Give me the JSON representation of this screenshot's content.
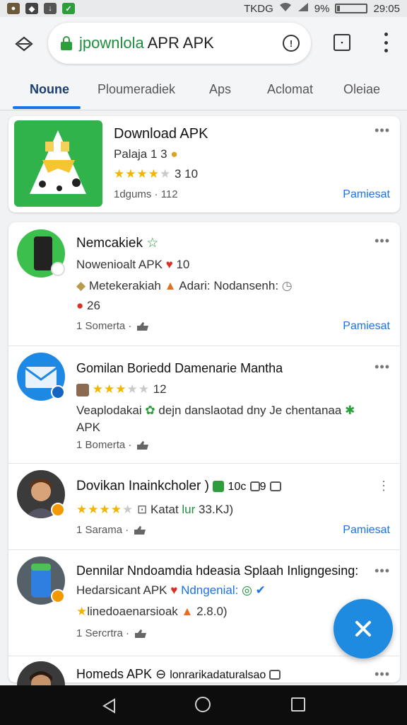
{
  "status_bar": {
    "carrier": "TKDG",
    "battery": "9%",
    "battery_level": 0.09,
    "time": "29:05"
  },
  "browser": {
    "url_green": "jpownlola",
    "url_rest": " APR APK"
  },
  "tabs": [
    {
      "label": "Noune"
    },
    {
      "label": "Ploumeradiek"
    },
    {
      "label": "Aps"
    },
    {
      "label": "Aclomat"
    },
    {
      "label": "Oleiae"
    }
  ],
  "cards": {
    "c1": {
      "title": "Download APK",
      "line1": "Palaja 1 3",
      "rating": 4,
      "rating_text": "3 10",
      "meta": "1dgums · 112",
      "action": "Pamiesat"
    },
    "c2": {
      "title": "Nemcakiek",
      "line1": "Nowenioalt APK",
      "line1_count": "10",
      "line2": "Metekerakiah",
      "line2b": "Adari: Nodansenh:",
      "line3": "26",
      "meta": "1 Somerta ·",
      "action": "Pamiesat"
    },
    "c3": {
      "title": "Gomilan Boriedd Damenarie Mantha",
      "rating": 3,
      "rating_text": "12",
      "line1": "Veaplodakai",
      "line1b": "dejn danslaotad dny Je chentanaa",
      "line2": "APK",
      "meta": "1 Bomerta ·"
    },
    "c4": {
      "title": "Dovikan Inainkcholer )",
      "title_b": "10c",
      "title_c": "9",
      "rating": 4,
      "extra": "Katat",
      "extra_g": "lur",
      "extra_b": "33.KJ)",
      "meta": "1 Sarama ·",
      "action": "Pamiesat"
    },
    "c5": {
      "title": "Dennilar Nndoamdia hdeasia Splaah Inligngesing:",
      "line1": "Hedarsicant APK",
      "line1_g": "Ndngenial:",
      "line2": "linedoaenarsioak",
      "line2b": "2.8.0)",
      "meta": "1 Sercrtra ·"
    },
    "c6": {
      "title": "Homeds APK",
      "title_b": "lonrarikadaturalsao"
    }
  },
  "fab": {
    "icon": "close-icon"
  },
  "colors": {
    "accent": "#1a73e8",
    "star": "#f5b400",
    "fab": "#1f8be0",
    "tab_active": "#1a3e70",
    "green": "#1e8e3e"
  }
}
